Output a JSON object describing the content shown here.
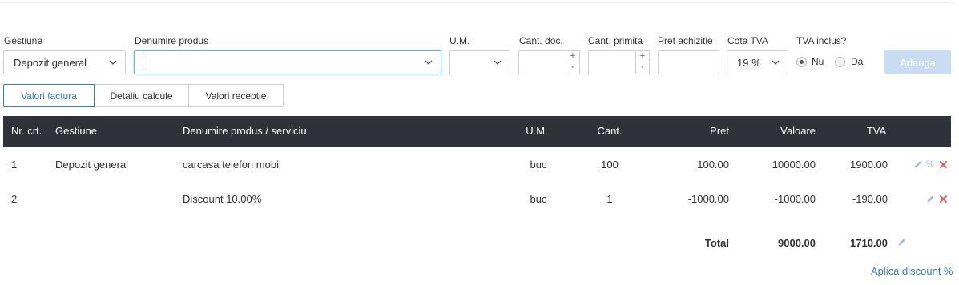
{
  "form": {
    "gestiune_label": "Gestiune",
    "gestiune_value": "Depozit general",
    "produs_label": "Denumire produs",
    "um_label": "U.M.",
    "cant_doc_label": "Cant. doc.",
    "cant_primita_label": "Cant. primita",
    "pret_label": "Pret achizitie",
    "cota_label": "Cota TVA",
    "cota_value": "19 %",
    "tva_inclus_label": "TVA inclus?",
    "radio_nu": "Nu",
    "radio_da": "Da",
    "radio_selected": "Nu",
    "spin_plus": "+",
    "spin_minus": "-",
    "add_button": "Adauga"
  },
  "tabs": [
    {
      "label": "Valori factura",
      "active": true
    },
    {
      "label": "Detaliu calcule",
      "active": false
    },
    {
      "label": "Valori receptie",
      "active": false
    }
  ],
  "table": {
    "headers": {
      "nr": "Nr. crt.",
      "gestiune": "Gestiune",
      "denumire": "Denumire produs / serviciu",
      "um": "U.M.",
      "cant": "Cant.",
      "pret": "Pret",
      "valoare": "Valoare",
      "tva": "TVA"
    },
    "rows": [
      {
        "nr": "1",
        "gestiune": "Depozit general",
        "denumire": "carcasa telefon mobil",
        "um": "buc",
        "cant": "100",
        "pret": "100.00",
        "valoare": "10000.00",
        "tva": "1900.00",
        "pct": "%"
      },
      {
        "nr": "2",
        "gestiune": "",
        "denumire": "Discount 10.00%",
        "um": "buc",
        "cant": "1",
        "pret": "-1000.00",
        "valoare": "-1000.00",
        "tva": "-190.00"
      }
    ],
    "total_label": "Total",
    "total_valoare": "9000.00",
    "total_tva": "1710.00"
  },
  "discount_link": "Aplica discount %",
  "colors": {
    "accent": "#3a7fc4",
    "header_bg": "#2f3339",
    "add_button_bg": "#c8dcf3",
    "delete": "#e35d5d",
    "edit": "#9cb7dc"
  }
}
